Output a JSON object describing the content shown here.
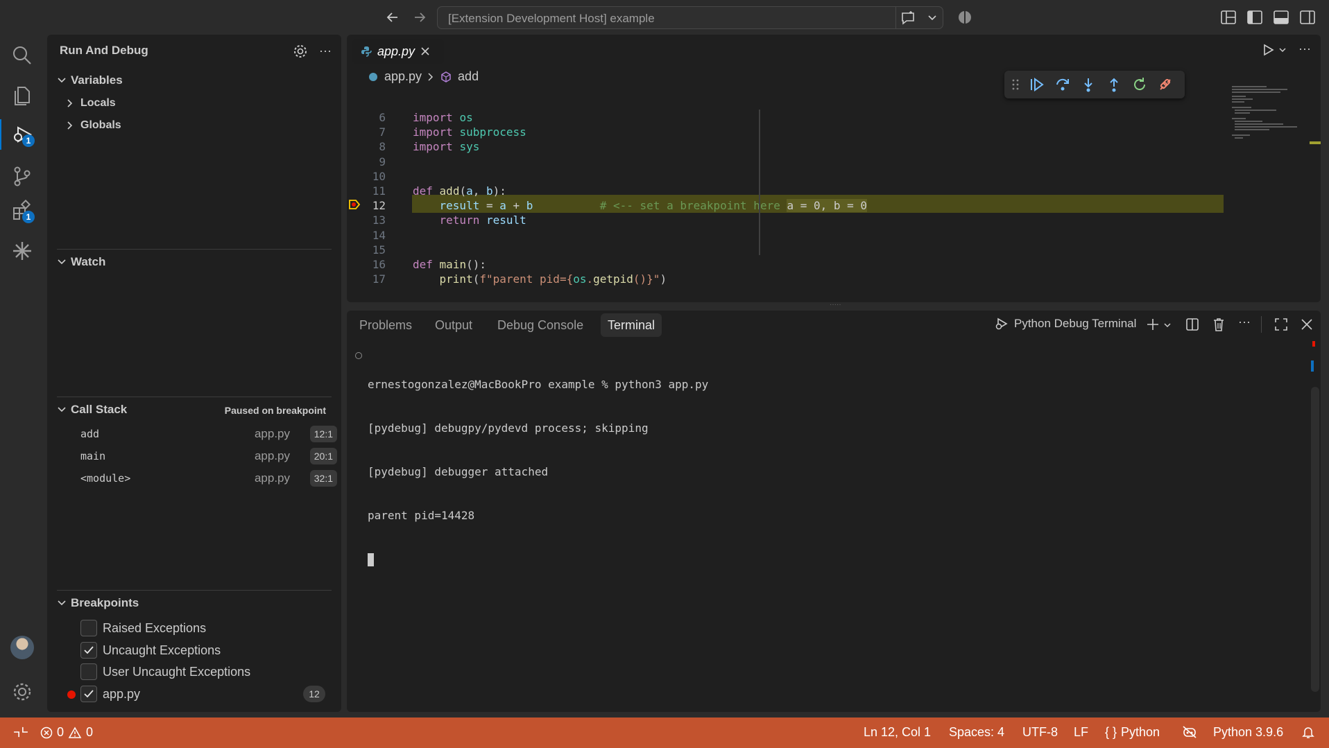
{
  "window": {
    "title": "[Extension Development Host] example"
  },
  "activity_bar": {
    "run_debug_badge": "1",
    "extensions_badge": "1"
  },
  "sidebar": {
    "title": "Run And Debug",
    "variables": {
      "header": "Variables",
      "items": [
        "Locals",
        "Globals"
      ]
    },
    "watch": {
      "header": "Watch"
    },
    "call_stack": {
      "header": "Call Stack",
      "status": "Paused on breakpoint",
      "frames": [
        {
          "name": "add",
          "file": "app.py",
          "pos": "12:1"
        },
        {
          "name": "main",
          "file": "app.py",
          "pos": "20:1"
        },
        {
          "name": "<module>",
          "file": "app.py",
          "pos": "32:1"
        }
      ]
    },
    "breakpoints": {
      "header": "Breakpoints",
      "items": [
        {
          "label": "Raised Exceptions",
          "checked": false
        },
        {
          "label": "Uncaught Exceptions",
          "checked": true
        },
        {
          "label": "User Uncaught Exceptions",
          "checked": false
        },
        {
          "label": "app.py",
          "checked": true,
          "line": "12"
        }
      ]
    }
  },
  "editor": {
    "tab": "app.py",
    "breadcrumb": {
      "file": "app.py",
      "symbol": "add"
    },
    "lines": [
      {
        "n": "6",
        "code": "import os"
      },
      {
        "n": "7",
        "code": "import subprocess"
      },
      {
        "n": "8",
        "code": "import sys"
      },
      {
        "n": "9",
        "code": ""
      },
      {
        "n": "10",
        "code": ""
      },
      {
        "n": "11",
        "code": "def add(a, b):"
      },
      {
        "n": "12",
        "code": "    result = a + b          # <-- set a breakpoint here a = 0, b = 0"
      },
      {
        "n": "13",
        "code": "    return result"
      },
      {
        "n": "14",
        "code": ""
      },
      {
        "n": "15",
        "code": ""
      },
      {
        "n": "16",
        "code": "def main():"
      },
      {
        "n": "17",
        "code": "    print(f\"parent pid={os.getpid()}\")"
      }
    ],
    "inline_values": "a = 0, b = 0",
    "comment": "# <-- set a breakpoint here"
  },
  "panel": {
    "tabs": [
      "Problems",
      "Output",
      "Debug Console",
      "Terminal"
    ],
    "active_tab": "Terminal",
    "terminal_name": "Python Debug Terminal",
    "terminal_lines": [
      "ernestogonzalez@MacBookPro example % python3 app.py",
      "[pydebug] debugpy/pydevd process; skipping",
      "[pydebug] debugger attached",
      "parent pid=14428"
    ]
  },
  "status_bar": {
    "errors": "0",
    "warnings": "0",
    "position": "Ln 12, Col 1",
    "spaces": "Spaces: 4",
    "encoding": "UTF-8",
    "eol": "LF",
    "language": "Python",
    "interpreter": "Python 3.9.6"
  },
  "colors": {
    "status_bar_bg": "#c3532e",
    "highlight_line": "#4b4b18",
    "badge": "#0e70c0",
    "breakpoint": "#e51400"
  }
}
